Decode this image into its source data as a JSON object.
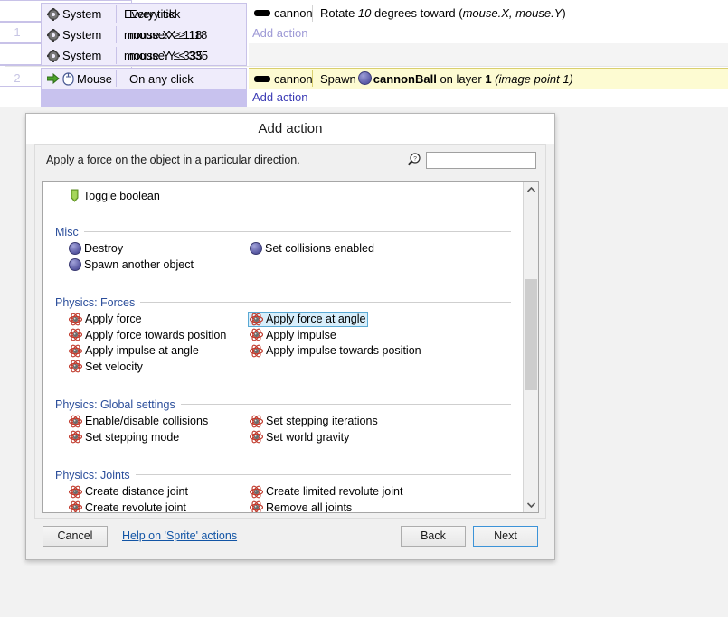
{
  "event_sheet": {
    "rows": [
      {
        "number": "1",
        "conditions": [
          {
            "icon": "gear-icon",
            "object": "System",
            "text": "Every tick"
          },
          {
            "icon": "gear-icon",
            "object": "System",
            "text": "mouse.X ≥ 118"
          },
          {
            "icon": "gear-icon",
            "object": "System",
            "text": "mouse.Y ≤ 335"
          }
        ],
        "actions": [
          {
            "icon": "cannon-icon",
            "object": "cannon",
            "text_prefix": "Rotate ",
            "value": "10",
            "text_suffix": " degrees toward (",
            "params": "mouse.X, mouse.Y",
            "text_end": ")"
          }
        ],
        "add_action_label": "Add action"
      },
      {
        "number": "2",
        "conditions": [
          {
            "icon": "mouse-icon",
            "object": "Mouse",
            "text": "On any click"
          }
        ],
        "actions": [
          {
            "icon": "cannon-icon",
            "object": "cannon",
            "verb": "Spawn",
            "target": "cannonBall",
            "mid": " on layer ",
            "layer": "1",
            "note": "(image point 1)"
          }
        ],
        "add_action_label": "Add action"
      }
    ]
  },
  "dialog": {
    "title": "Add action",
    "description": "Apply a force on the object in a particular direction.",
    "search": {
      "value": "",
      "placeholder": ""
    },
    "search_icon": "magnifier-help-icon",
    "list": {
      "leading_items": [
        {
          "icon": "boolean-icon",
          "label": "Toggle boolean"
        }
      ],
      "groups": [
        {
          "title": "Misc",
          "items": [
            {
              "icon": "object-icon",
              "label": "Destroy"
            },
            {
              "icon": "object-icon",
              "label": "Set collisions enabled"
            },
            {
              "icon": "object-icon",
              "label": "Spawn another object"
            }
          ]
        },
        {
          "title": "Physics: Forces",
          "items": [
            {
              "icon": "physics-icon",
              "label": "Apply force"
            },
            {
              "icon": "physics-icon",
              "label": "Apply force at angle",
              "selected": true
            },
            {
              "icon": "physics-icon",
              "label": "Apply force towards position"
            },
            {
              "icon": "physics-icon",
              "label": "Apply impulse"
            },
            {
              "icon": "physics-icon",
              "label": "Apply impulse at angle"
            },
            {
              "icon": "physics-icon",
              "label": "Apply impulse towards position"
            },
            {
              "icon": "physics-icon",
              "label": "Set velocity"
            }
          ]
        },
        {
          "title": "Physics: Global settings",
          "items": [
            {
              "icon": "physics-icon",
              "label": "Enable/disable collisions"
            },
            {
              "icon": "physics-icon",
              "label": "Set stepping iterations"
            },
            {
              "icon": "physics-icon",
              "label": "Set stepping mode"
            },
            {
              "icon": "physics-icon",
              "label": "Set world gravity"
            }
          ]
        },
        {
          "title": "Physics: Joints",
          "items": [
            {
              "icon": "physics-icon",
              "label": "Create distance joint"
            },
            {
              "icon": "physics-icon",
              "label": "Create limited revolute joint"
            },
            {
              "icon": "physics-icon",
              "label": "Create revolute joint"
            },
            {
              "icon": "physics-icon",
              "label": "Remove all joints"
            }
          ]
        }
      ]
    },
    "footer": {
      "cancel_label": "Cancel",
      "help_label": "Help on 'Sprite' actions",
      "back_label": "Back",
      "next_label": "Next"
    },
    "scrollbar": {
      "up_icon": "chevron-up-icon",
      "down_icon": "chevron-down-icon"
    }
  },
  "colors": {
    "accent_blue": "#2b4e9b",
    "selection_fill": "#d7eefb",
    "selection_border": "#5aa9d4",
    "condition_fill": "#efecfb",
    "action_highlight": "#fdfbd2",
    "link": "#1154a5"
  }
}
